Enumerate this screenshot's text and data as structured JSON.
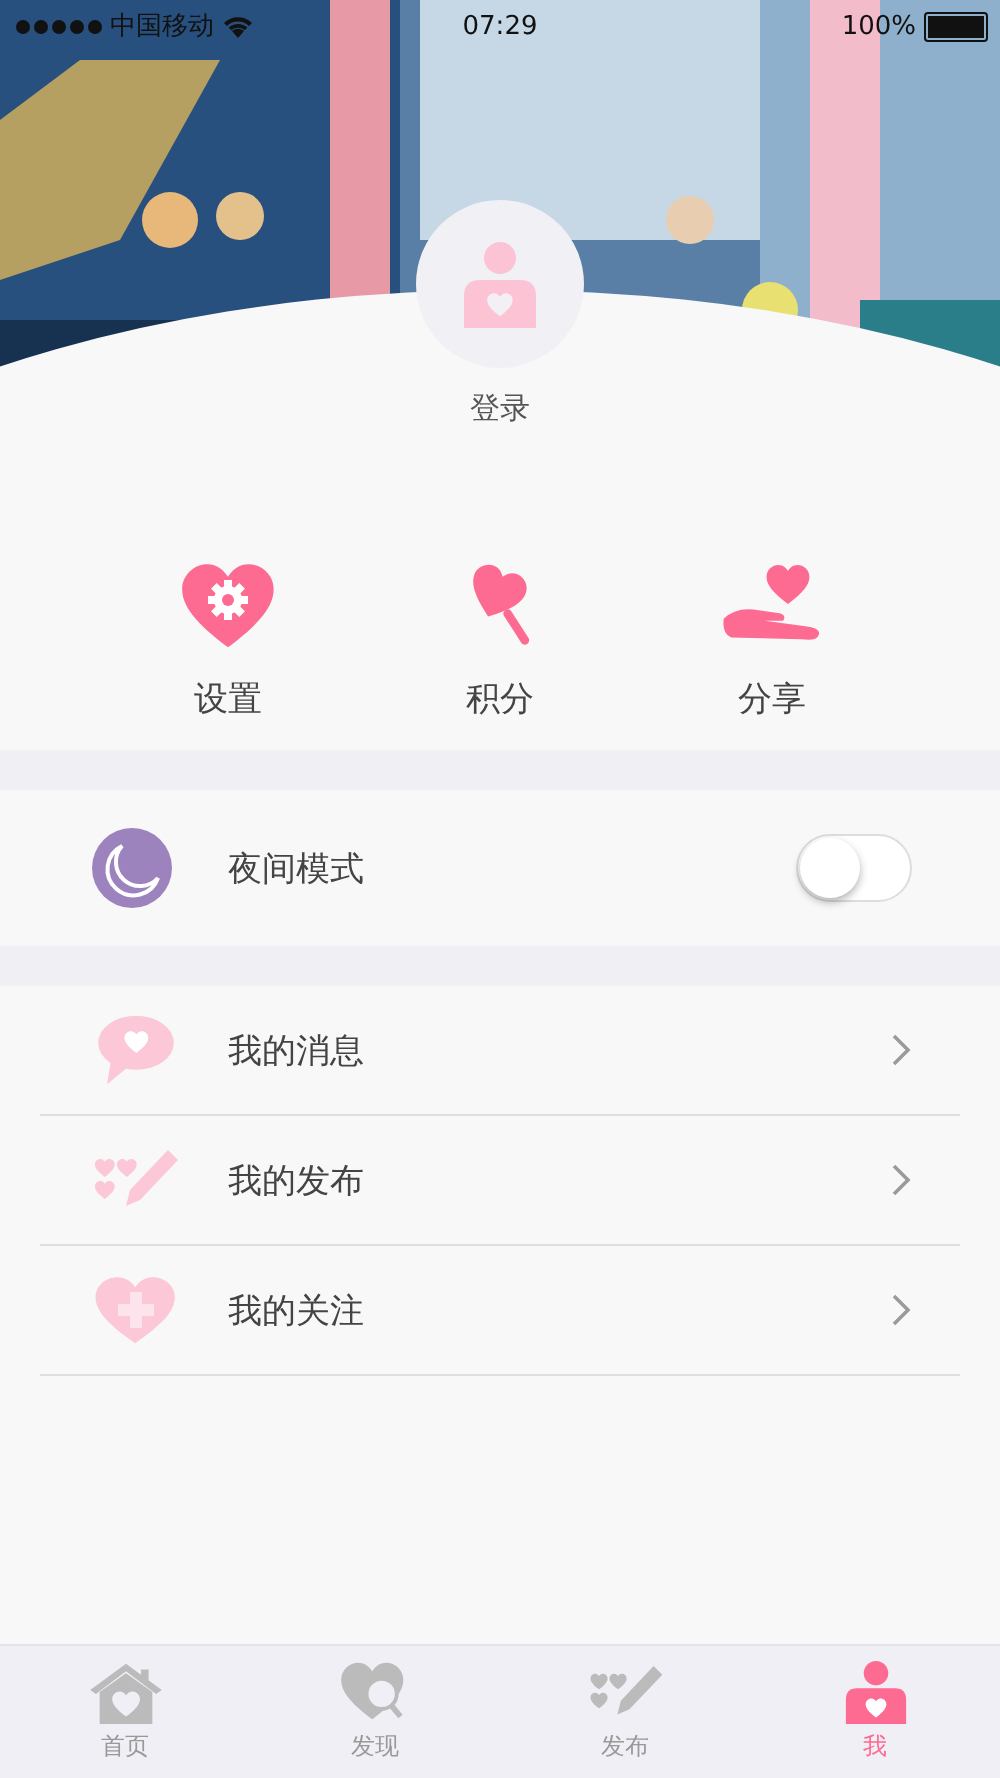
{
  "status_bar": {
    "carrier": "中国移动",
    "time": "07:29",
    "battery": "100%"
  },
  "profile": {
    "login": "登录"
  },
  "quick_actions": [
    {
      "kind": "settings",
      "label": "设置"
    },
    {
      "kind": "points",
      "label": "积分"
    },
    {
      "kind": "share",
      "label": "分享"
    }
  ],
  "night_mode": {
    "label": "夜间模式",
    "on": false
  },
  "menu": [
    {
      "kind": "messages",
      "label": "我的消息"
    },
    {
      "kind": "posts",
      "label": "我的发布"
    },
    {
      "kind": "follows",
      "label": "我的关注"
    }
  ],
  "tab_bar": [
    {
      "kind": "home",
      "label": "首页",
      "selected": false
    },
    {
      "kind": "discover",
      "label": "发现",
      "selected": false
    },
    {
      "kind": "publish",
      "label": "发布",
      "selected": false
    },
    {
      "kind": "me",
      "label": "我",
      "selected": true
    }
  ]
}
